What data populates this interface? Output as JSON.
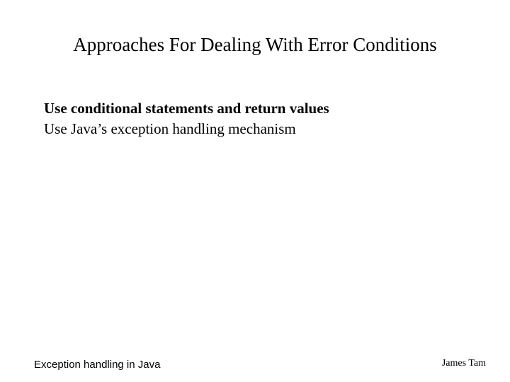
{
  "slide": {
    "title": "Approaches For Dealing With Error Conditions",
    "bullets": [
      {
        "text": "Use conditional statements and return values",
        "bold": true
      },
      {
        "text": "Use Java’s exception handling mechanism",
        "bold": false
      }
    ],
    "footer_left": "Exception handling in Java",
    "footer_right": "James Tam"
  }
}
